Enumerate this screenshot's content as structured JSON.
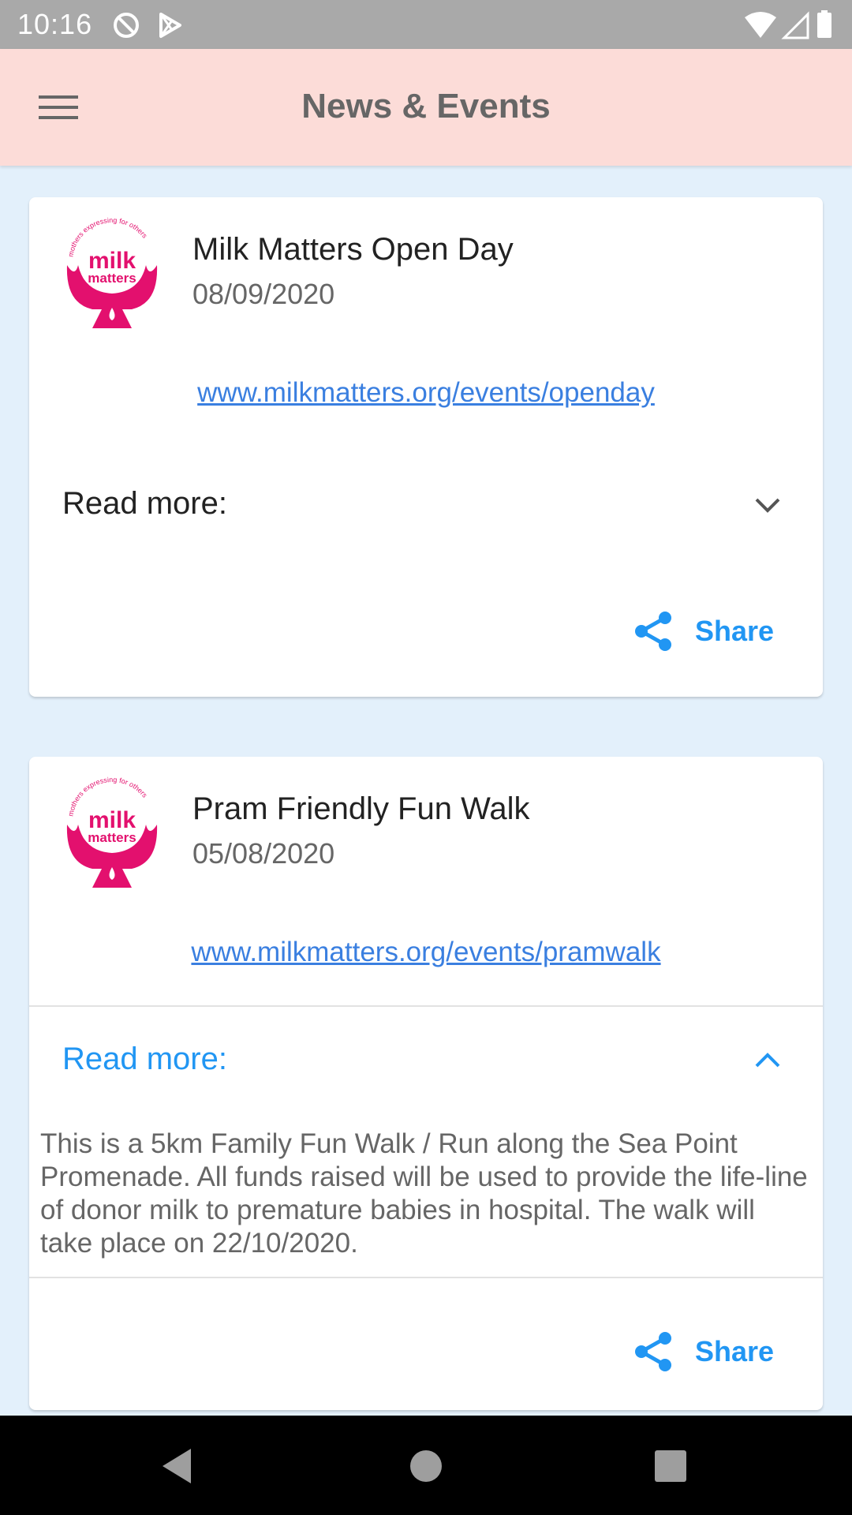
{
  "status_bar": {
    "time": "10:16"
  },
  "app_bar": {
    "title": "News & Events"
  },
  "events": [
    {
      "title": "Milk Matters Open Day",
      "date": "08/09/2020",
      "link": "www.milkmatters.org/events/openday",
      "read_more_label": "Read more:",
      "expanded": false,
      "share_label": "Share"
    },
    {
      "title": "Pram Friendly Fun Walk",
      "date": "05/08/2020",
      "link": "www.milkmatters.org/events/pramwalk",
      "read_more_label": "Read more:",
      "expanded": true,
      "read_more_text": "This is a 5km Family Fun Walk / Run along the Sea Point Promenade.  All funds raised will be used to provide the life-line of donor milk to premature babies in hospital. The walk will take place on 22/10/2020.",
      "share_label": "Share"
    }
  ],
  "logo": {
    "top_text": "mothers expressing for others",
    "word1": "milk",
    "word2": "matters"
  },
  "colors": {
    "app_bar": "#fcdcd8",
    "background": "#e3f0fb",
    "accent": "#2196f3",
    "link": "#3a7fe0",
    "logo": "#e3106e"
  }
}
